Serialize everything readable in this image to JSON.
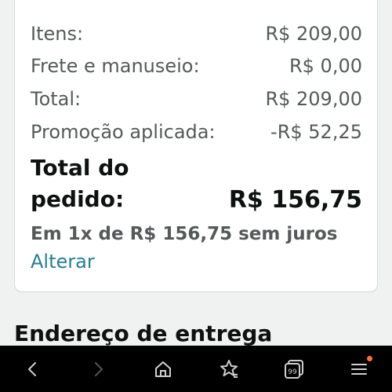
{
  "summary": {
    "items_label": "Itens:",
    "items_value": "R$ 209,00",
    "shipping_label": "Frete e manuseio:",
    "shipping_value": "R$ 0,00",
    "total_label": "Total:",
    "total_value": "R$ 209,00",
    "promo_label": "Promoção aplicada:",
    "promo_value": "-R$ 52,25",
    "order_total_label_line1": "Total do",
    "order_total_label_line2": "pedido:",
    "order_total_value": "R$ 156,75",
    "installments": "Em 1x de R$ 156,75 sem juros",
    "change_link": "Alterar"
  },
  "section": {
    "title": "Endereço de entrega"
  },
  "navbar": {
    "items": [
      {
        "icon": "back-icon"
      },
      {
        "icon": "forward-icon"
      },
      {
        "icon": "home-icon"
      },
      {
        "icon": "bookmarks-icon"
      },
      {
        "icon": "tabs-icon",
        "badge": "99"
      },
      {
        "icon": "menu-icon"
      }
    ],
    "notification_dot_color": "#ff6f43"
  }
}
